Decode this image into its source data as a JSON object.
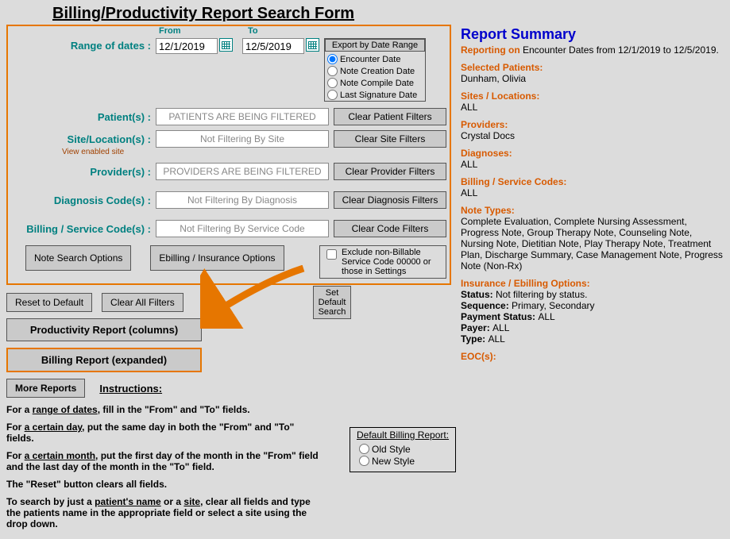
{
  "title": "Billing/Productivity Report Search Form",
  "dates": {
    "label": "Range of dates :",
    "from_label": "From",
    "to_label": "To",
    "from": "12/1/2019",
    "to": "12/5/2019"
  },
  "export": {
    "button": "Export by Date Range",
    "options": [
      "Encounter Date",
      "Note Creation Date",
      "Note Compile Date",
      "Last Signature Date"
    ]
  },
  "filters": {
    "patient": {
      "label": "Patient(s) :",
      "value": "PATIENTS ARE BEING FILTERED",
      "clear": "Clear Patient Filters"
    },
    "site": {
      "label": "Site/Location(s) :",
      "value": "Not Filtering By Site",
      "clear": "Clear Site Filters",
      "hint": "View enabled site"
    },
    "provider": {
      "label": "Provider(s) :",
      "value": "PROVIDERS ARE BEING FILTERED",
      "clear": "Clear Provider Filters"
    },
    "diag": {
      "label": "Diagnosis Code(s) :",
      "value": "Not Filtering By Diagnosis",
      "clear": "Clear Diagnosis Filters"
    },
    "svc": {
      "label": "Billing / Service Code(s) :",
      "value": "Not Filtering By Service Code",
      "clear": "Clear Code Filters"
    }
  },
  "options": {
    "note_search": "Note Search Options",
    "ebilling": "Ebilling / Insurance Options",
    "exclude": "Exclude non-Billable Service Code 00000 or those in Settings"
  },
  "buttons": {
    "reset": "Reset to Default",
    "clear_all": "Clear All Filters",
    "productivity": "Productivity Report (columns)",
    "billing": "Billing Report (expanded)",
    "more": "More Reports",
    "set_default": "Set Default Search"
  },
  "instructions": {
    "title": "Instructions:",
    "p1_a": "For a ",
    "p1_u": "range of dates",
    "p1_b": ", fill in the \"From\" and \"To\" fields.",
    "p2_a": "For ",
    "p2_u": "a certain day",
    "p2_b": ", put the same day in both the \"From\" and \"To\" fields.",
    "p3_a": "For ",
    "p3_u": "a certain month",
    "p3_b": ", put the first day of the month in the \"From\"  field and the last day of the month in the \"To\" field.",
    "p4": "The \"Reset\" button clears all fields.",
    "p5_a": "To search by just a ",
    "p5_u1": "patient's name",
    "p5_b": " or a ",
    "p5_u2": "site",
    "p5_c": ", clear all fields and type the patients name in the appropriate field or select a site using the drop down."
  },
  "default_report": {
    "title": "Default Billing Report:",
    "opt1": "Old Style",
    "opt2": "New Style"
  },
  "summary": {
    "title": "Report Summary",
    "reporting_a": "Reporting on ",
    "reporting_b": "Encounter Dates from 12/1/2019 to 12/5/2019.",
    "patients_h": "Selected Patients:",
    "patients_v": "Dunham, Olivia",
    "sites_h": "Sites / Locations:",
    "sites_v": "ALL",
    "providers_h": "Providers:",
    "providers_v": "Crystal Docs",
    "diag_h": "Diagnoses:",
    "diag_v": "ALL",
    "svc_h": "Billing / Service Codes:",
    "svc_v": "ALL",
    "notes_h": "Note Types:",
    "notes_v": "Complete Evaluation, Complete Nursing Assessment, Progress Note, Group Therapy Note, Counseling Note, Nursing Note, Dietitian Note, Play Therapy Note, Treatment Plan, Discharge Summary, Case Management Note, Progress Note (Non-Rx)",
    "ins_h": "Insurance / Ebilling Options:",
    "ins_status_l": "Status: ",
    "ins_status_v": "Not filtering by status.",
    "ins_seq_l": "Sequence: ",
    "ins_seq_v": "Primary, Secondary",
    "ins_pay_l": "Payment Status: ",
    "ins_pay_v": "ALL",
    "ins_payer_l": "Payer: ",
    "ins_payer_v": "ALL",
    "ins_type_l": "Type: ",
    "ins_type_v": "ALL",
    "eoc_h": "EOC(s):"
  }
}
